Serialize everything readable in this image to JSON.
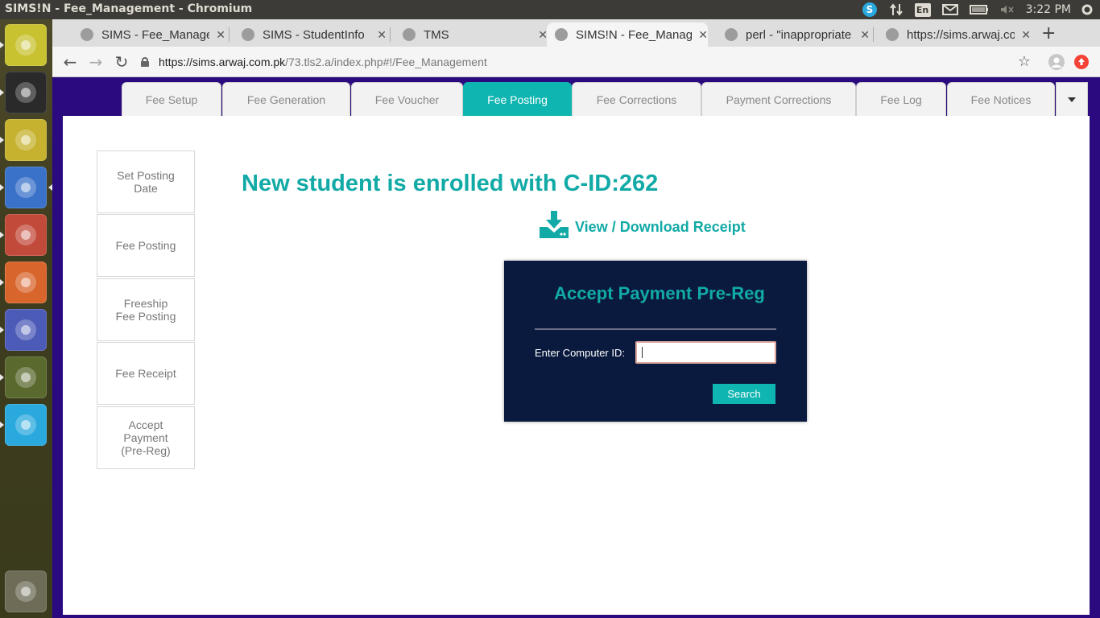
{
  "os": {
    "window_title": "SIMS!N - Fee_Management - Chromium",
    "keyboard_layout": "En",
    "clock": "3:22 PM",
    "launcher": [
      {
        "name": "ubuntu-dash-icon",
        "color": "#c9c230"
      },
      {
        "name": "terminal-icon",
        "color": "#2a2a2a"
      },
      {
        "name": "teapot-icon",
        "color": "#c6b22e"
      },
      {
        "name": "chromium-icon",
        "color": "#3a72c9"
      },
      {
        "name": "file-cabinet-icon",
        "color": "#c24a3a"
      },
      {
        "name": "archive-manager-icon",
        "color": "#d8652c"
      },
      {
        "name": "wallpaper-app-icon",
        "color": "#4d5bb8"
      },
      {
        "name": "software-updater-icon",
        "color": "#5a6a2e"
      },
      {
        "name": "splash-app-icon",
        "color": "#2aa9de"
      },
      {
        "name": "trash-icon",
        "color": "#6e6b56"
      }
    ]
  },
  "browser": {
    "tabs": [
      {
        "label": "SIMS - Fee_Management",
        "active": false
      },
      {
        "label": "SIMS - StudentInfo",
        "active": false
      },
      {
        "label": "TMS",
        "active": false
      },
      {
        "label": "SIMS!N - Fee_Management",
        "active": true
      },
      {
        "label": "perl - \"inappropriate ioctl for device\"",
        "active": false
      },
      {
        "label": "https://sims.arwaj.com.pk",
        "active": false
      }
    ],
    "url_host": "https://sims.arwaj.com.pk",
    "url_path": "/73.tls2.a/index.php#!/Fee_Management"
  },
  "module_tabs": [
    {
      "label": "Fee Setup",
      "active": false
    },
    {
      "label": "Fee Generation",
      "active": false
    },
    {
      "label": "Fee Voucher",
      "active": false
    },
    {
      "label": "Fee Posting",
      "active": true
    },
    {
      "label": "Fee Corrections",
      "active": false
    },
    {
      "label": "Payment Corrections",
      "active": false
    },
    {
      "label": "Fee Log",
      "active": false
    },
    {
      "label": "Fee Notices",
      "active": false
    }
  ],
  "side_menu": [
    {
      "label": "Set Posting\nDate"
    },
    {
      "label": "Fee Posting"
    },
    {
      "label": "Freeship\nFee Posting"
    },
    {
      "label": "Fee Receipt"
    },
    {
      "label": "Accept\nPayment\n(Pre-Reg)"
    }
  ],
  "main": {
    "enroll_message": "New student is enrolled with C-ID:262",
    "receipt_link": "View / Download Receipt",
    "panel": {
      "title": "Accept Payment Pre-Reg",
      "field_label": "Enter Computer ID:",
      "field_value": "",
      "button_label": "Search"
    }
  },
  "colors": {
    "accent": "#0fb5b0",
    "page_background": "#2a0a7e",
    "panel_background": "#0a1a3e",
    "launcher": "#3e3c1e"
  }
}
